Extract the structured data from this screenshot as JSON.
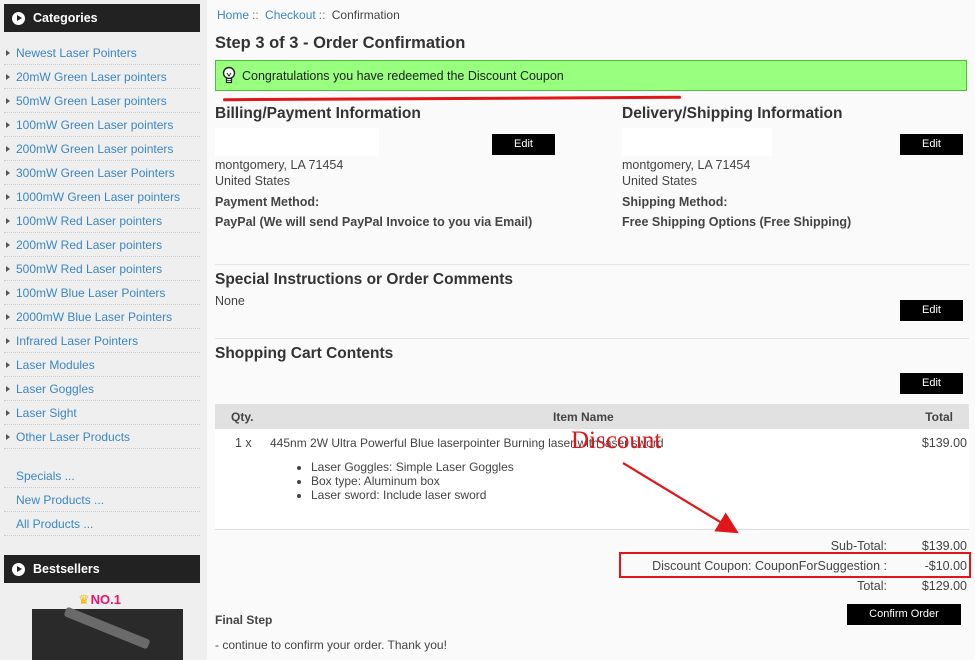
{
  "sidebar": {
    "categories_title": "Categories",
    "categories": [
      "Newest Laser Pointers",
      "20mW Green Laser pointers",
      "50mW Green Laser pointers",
      "100mW Green Laser pointers",
      "200mW Green Laser pointers",
      "300mW Green Laser Pointers",
      "1000mW Green Laser pointers",
      "100mW Red Laser pointers",
      "200mW Red Laser pointers",
      "500mW Red Laser pointers",
      "100mW Blue Laser Pointers",
      "2000mW Blue Laser Pointers",
      "Infrared Laser Pointers",
      "Laser Modules",
      "Laser Goggles",
      "Laser Sight",
      "Other Laser Products"
    ],
    "extra_links": [
      "Specials ...",
      "New Products ...",
      "All Products ..."
    ],
    "bestsellers_title": "Bestsellers",
    "bestseller_rank": "NO.1"
  },
  "breadcrumb": {
    "home": "Home",
    "checkout": "Checkout",
    "current": "Confirmation",
    "separator": "::"
  },
  "page_title": "Step 3 of 3 - Order Confirmation",
  "message": "Congratulations you have redeemed the Discount Coupon",
  "billing": {
    "title": "Billing/Payment Information",
    "edit_label": "Edit",
    "city_line": "montgomery, LA 71454",
    "country": "United States",
    "method_title": "Payment Method:",
    "method_value": "PayPal (We will send PayPal Invoice to you via Email)"
  },
  "delivery": {
    "title": "Delivery/Shipping Information",
    "edit_label": "Edit",
    "city_line": "montgomery, LA 71454",
    "country": "United States",
    "method_title": "Shipping Method:",
    "method_value": "Free Shipping Options (Free Shipping)"
  },
  "instructions": {
    "title": "Special Instructions or Order Comments",
    "value": "None",
    "edit_label": "Edit"
  },
  "cart": {
    "title": "Shopping Cart Contents",
    "edit_label": "Edit",
    "columns": {
      "qty": "Qty.",
      "item": "Item Name",
      "total": "Total"
    },
    "item": {
      "qty": "1 x",
      "name": "445nm 2W Ultra Powerful Blue laserpointer Burning laser with laser sword",
      "total": "$139.00",
      "attributes": [
        "Laser Goggles: Simple Laser Goggles",
        "Box type: Aluminum box",
        "Laser sword: Include laser sword"
      ]
    }
  },
  "totals": {
    "subtotal_label": "Sub-Total:",
    "subtotal_value": "$139.00",
    "discount_label": "Discount Coupon: CouponForSuggestion :",
    "discount_value": "-$10.00",
    "total_label": "Total:",
    "total_value": "$129.00"
  },
  "annotation": {
    "text": "Discount",
    "color": "#e0161b"
  },
  "final_step": {
    "title": "Final Step",
    "text": "- continue to confirm your order. Thank you!",
    "confirm_label": "Confirm Order"
  },
  "colors": {
    "link": "#3a86c4",
    "success_bg": "#99ff7f",
    "button_bg": "#000000",
    "sidebar_header": "#222222"
  }
}
